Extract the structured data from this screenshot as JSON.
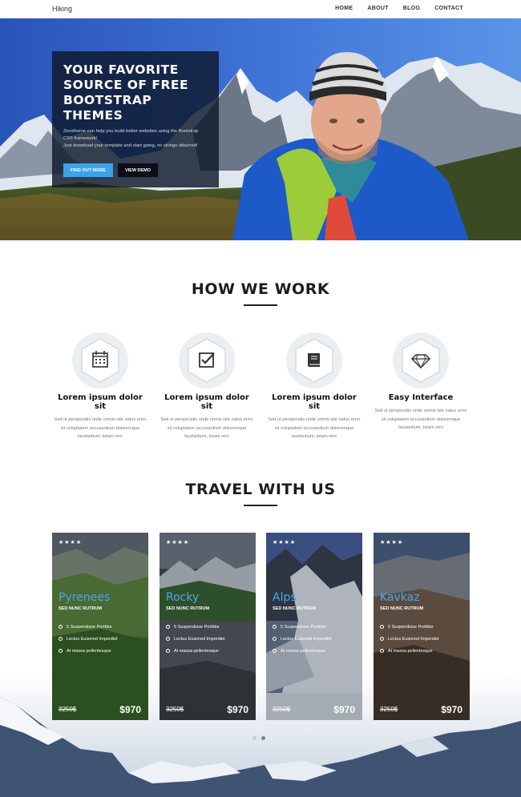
{
  "nav": {
    "brand": "Hiking",
    "items": [
      "HOME",
      "ABOUT",
      "BLOG",
      "CONTACT"
    ]
  },
  "hero": {
    "title_lines": [
      "YOUR FAVORITE",
      "SOURCE OF FREE",
      "BOOTSTRAP THEMES"
    ],
    "text_lines": [
      "Zerotheme can help you build better websites using the Bootstrap",
      "CSS framework!",
      "Just download your template and start going, no strings attached!"
    ],
    "primary_button": "FIND OUT MORE",
    "secondary_button": "VIEW DEMO"
  },
  "how_we_work": {
    "title": "HOW WE WORK",
    "features": [
      {
        "icon": "calendar-icon",
        "title": "Lorem ipsum dolor sit",
        "text": "Sed ut perspiciatis unde omnis iste natus error sit voluptatem accusantium doloremque laudantium, totam rem"
      },
      {
        "icon": "checkbox-edit-icon",
        "title": "Lorem ipsum dolor sit",
        "text": "Sed ut perspiciatis unde omnis iste natus error sit voluptatem accusantium doloremque laudantium, totam rem"
      },
      {
        "icon": "book-icon",
        "title": "Lorem ipsum dolor sit",
        "text": "Sed ut perspiciatis unde omnis iste natus error sit voluptatem accusantium doloremque laudantium, totam rem"
      },
      {
        "icon": "diamond-icon",
        "title": "Easy Interface",
        "text": "Sed ut perspiciatis unde omnis iste natus error sit voluptatem accusantium doloremque laudantium, totam rem"
      }
    ]
  },
  "travel": {
    "title": "TRAVEL WITH US",
    "cards": [
      {
        "stars": "★★★★",
        "name": "Pyrenees",
        "subtitle": "SED NUNC RUTRUM",
        "items": [
          "5 Suspendisse Porttitor",
          "Lectus Euismod Imperdiet",
          "At massa pellentesque"
        ],
        "old_price": "3250$",
        "price": "$970"
      },
      {
        "stars": "★★★★",
        "name": "Rocky",
        "subtitle": "SED NUNC RUTRUM",
        "items": [
          "5 Suspendisse Porttitor",
          "Lectus Euismod Imperdiet",
          "At massa pellentesque"
        ],
        "old_price": "3250$",
        "price": "$970"
      },
      {
        "stars": "★★★★",
        "name": "Alps",
        "subtitle": "SED NUNC RUTRUM",
        "items": [
          "5 Suspendisse Porttitor",
          "Lectus Euismod Imperdiet",
          "At massa pellentesque"
        ],
        "old_price": "3250$",
        "price": "$970"
      },
      {
        "stars": "★★★★",
        "name": "Kavkaz",
        "subtitle": "SED NUNC RUTRUM",
        "items": [
          "5 Suspendisse Porttitor",
          "Lectus Euismod Imperdiet",
          "At massa pellentesque"
        ],
        "old_price": "3250$",
        "price": "$970"
      }
    ],
    "pagination": {
      "pages": 2,
      "active": 2
    }
  },
  "colors": {
    "accent": "#3ba3e6",
    "card_title": "#48a6e8",
    "hero_box": "#0e182c"
  }
}
